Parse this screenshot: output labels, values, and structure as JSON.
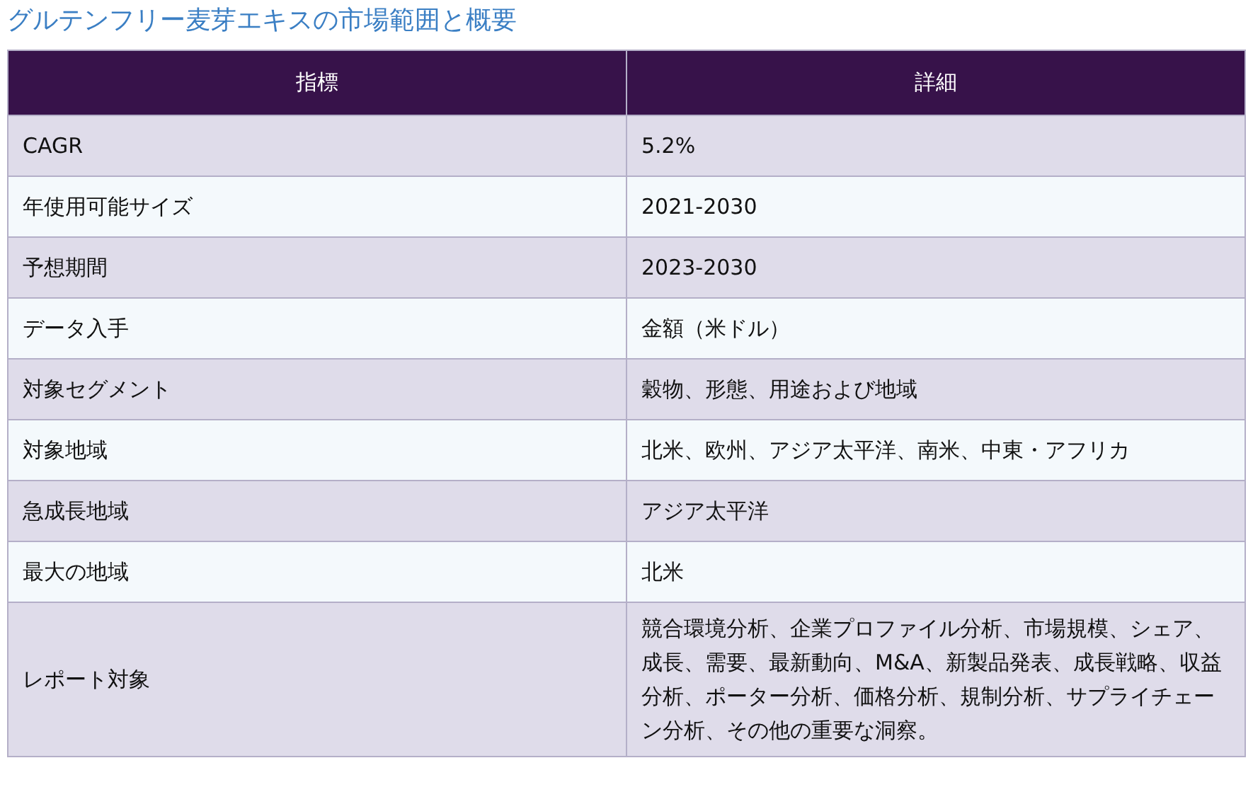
{
  "title": "グルテンフリー麦芽エキスの市場範囲と概要",
  "table": {
    "columns": [
      "指標",
      "詳細"
    ],
    "rows": [
      [
        "CAGR",
        "5.2%"
      ],
      [
        "年使用可能サイズ",
        "2021-2030"
      ],
      [
        "予想期間",
        "2023-2030"
      ],
      [
        "データ入手",
        "金額（米ドル）"
      ],
      [
        "対象セグメント",
        "穀物、形態、用途および地域"
      ],
      [
        "対象地域",
        "北米、欧州、アジア太平洋、南米、中東・アフリカ"
      ],
      [
        "急成長地域",
        "アジア太平洋"
      ],
      [
        "最大の地域",
        "北米"
      ],
      [
        "レポート対象",
        "競合環境分析、企業プロファイル分析、市場規模、シェア、成長、需要、最新動向、M&A、新製品発表、成長戦略、収益分析、ポーター分析、価格分析、規制分析、サプライチェーン分析、その他の重要な洞察。"
      ]
    ]
  }
}
